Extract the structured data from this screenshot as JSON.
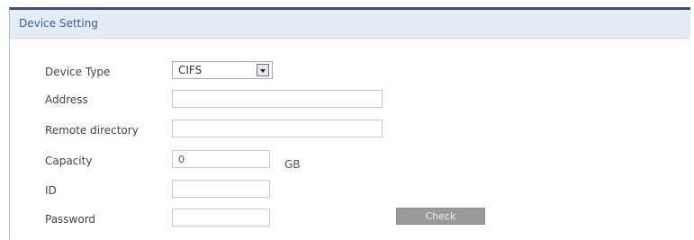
{
  "panel": {
    "title": "Device Setting"
  },
  "form": {
    "device_type": {
      "label": "Device Type",
      "value": "CIFS"
    },
    "address": {
      "label": "Address",
      "value": ""
    },
    "remote_directory": {
      "label": "Remote directory",
      "value": ""
    },
    "capacity": {
      "label": "Capacity",
      "value": "0",
      "unit": "GB"
    },
    "id": {
      "label": "ID",
      "value": ""
    },
    "password": {
      "label": "Password",
      "value": ""
    }
  },
  "buttons": {
    "check": "Check"
  }
}
